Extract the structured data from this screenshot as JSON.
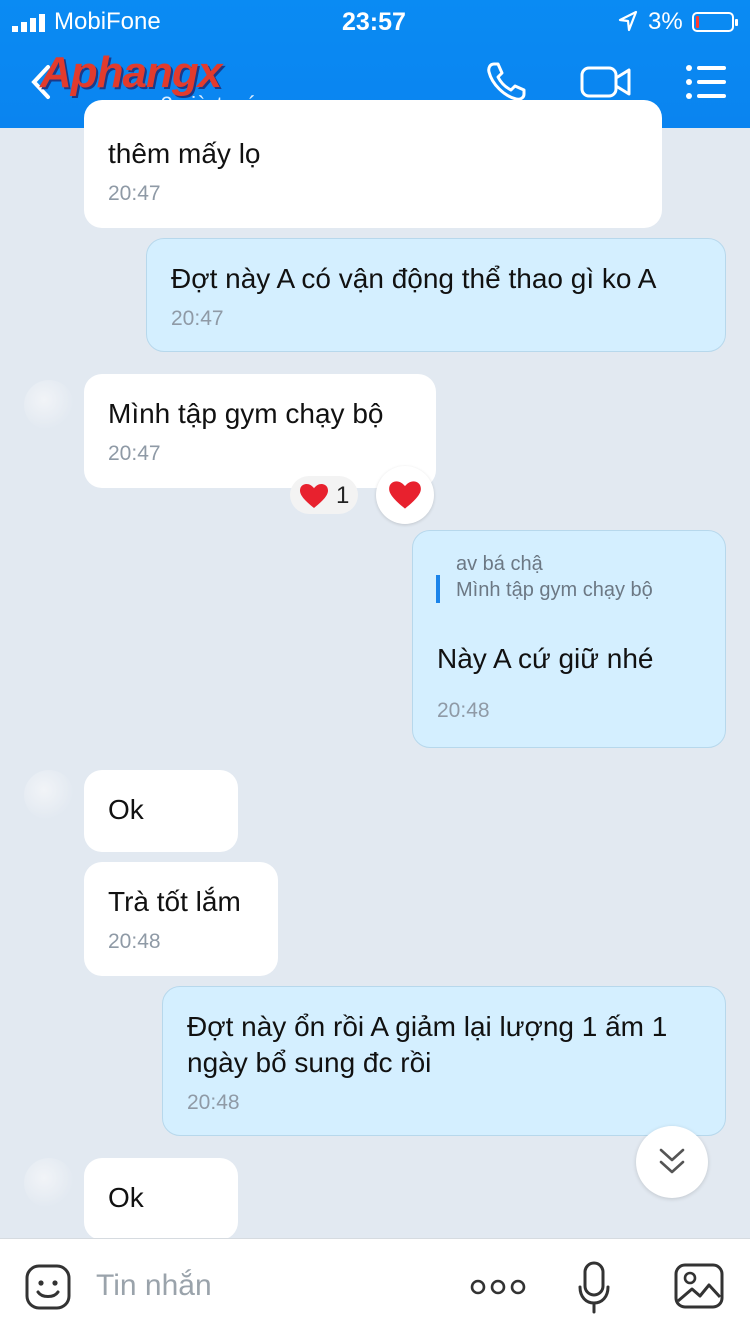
{
  "status_bar": {
    "carrier": "MobiFone",
    "time": "23:57",
    "battery": "3%"
  },
  "header": {
    "logo": "Aphangx",
    "subtitle": "ap 2 giờ trước"
  },
  "messages": [
    {
      "side": "in",
      "text": "thêm mấy lọ",
      "time": "20:47"
    },
    {
      "side": "out",
      "text": "Đợt này A có vận động thể thao gì ko A",
      "time": "20:47"
    },
    {
      "side": "in",
      "text": "Mình tập gym chạy bộ",
      "time": "20:47"
    },
    {
      "side": "out",
      "text": "Này A cứ giữ nhé",
      "time": "20:48"
    },
    {
      "side": "in",
      "text": "Ok",
      "time": ""
    },
    {
      "side": "in",
      "text": "Trà tốt lắm",
      "time": "20:48"
    },
    {
      "side": "out",
      "text": "Đợt này ổn rồi A giảm lại lượng 1 ấm 1 ngày bổ sung đc rồi",
      "time": "20:48"
    },
    {
      "side": "in",
      "text": "Ok",
      "time": ""
    }
  ],
  "reply": {
    "author": "av bá chậ",
    "quote": "Mình tập gym chạy bộ"
  },
  "reaction": {
    "count": "1",
    "icon": "heart-icon",
    "color": "#e8212e"
  },
  "composer": {
    "placeholder": "Tin nhắn"
  }
}
